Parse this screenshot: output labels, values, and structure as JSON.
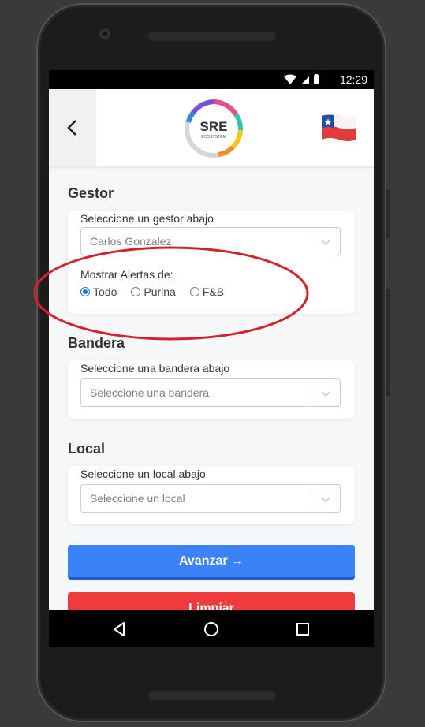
{
  "status_bar": {
    "time": "12:29"
  },
  "header": {
    "logo_text": "SRE",
    "logo_subtext": "ECOSYSTEM",
    "back_icon": "chevron-left-icon",
    "flag_icon": "chile-flag-icon"
  },
  "gestor": {
    "title": "Gestor",
    "label": "Seleccione un gestor abajo",
    "value": "Carlos Gonzalez",
    "alerts_label": "Mostrar Alertas de:",
    "options": [
      {
        "label": "Todo",
        "checked": true
      },
      {
        "label": "Purina",
        "checked": false
      },
      {
        "label": "F&B",
        "checked": false
      }
    ]
  },
  "bandera": {
    "title": "Bandera",
    "label": "Seleccione una bandera abajo",
    "placeholder": "Seleccione una bandera"
  },
  "local": {
    "title": "Local",
    "label": "Seleccione un local abajo",
    "placeholder": "Seleccione un local"
  },
  "buttons": {
    "advance": "Avanzar →",
    "clear": "Limpiar"
  },
  "colors": {
    "primary": "#3b82f6",
    "danger": "#ef3b3b",
    "annotation": "#d8202a",
    "radio_selected": "#1a73e8"
  }
}
